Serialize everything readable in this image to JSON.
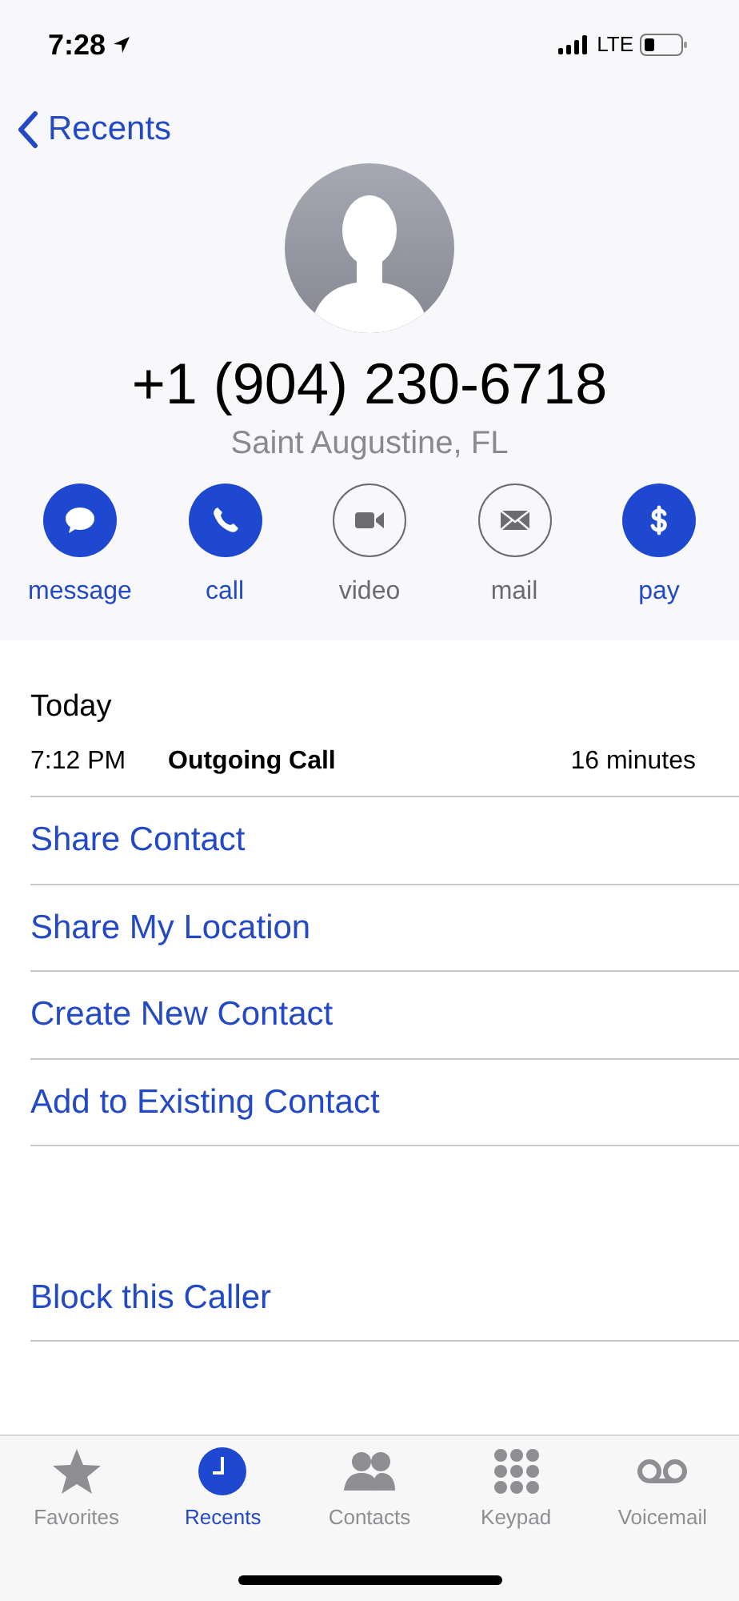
{
  "status_bar": {
    "time": "7:28",
    "network": "LTE"
  },
  "nav": {
    "back_label": "Recents"
  },
  "contact": {
    "number": "+1 (904) 230-6718",
    "location": "Saint Augustine, FL"
  },
  "actions": [
    {
      "kind": "message",
      "label": "message",
      "enabled": true
    },
    {
      "kind": "call",
      "label": "call",
      "enabled": true
    },
    {
      "kind": "video",
      "label": "video",
      "enabled": false
    },
    {
      "kind": "mail",
      "label": "mail",
      "enabled": false
    },
    {
      "kind": "pay",
      "label": "pay",
      "enabled": true
    }
  ],
  "history": {
    "heading": "Today",
    "calls": [
      {
        "time": "7:12 PM",
        "type": "Outgoing Call",
        "duration": "16 minutes"
      }
    ]
  },
  "links": [
    "Share Contact",
    "Share My Location",
    "Create New Contact",
    "Add to Existing Contact"
  ],
  "block_link": "Block this Caller",
  "tabs": [
    {
      "kind": "favorites",
      "label": "Favorites",
      "selected": false
    },
    {
      "kind": "recents",
      "label": "Recents",
      "selected": true
    },
    {
      "kind": "contacts",
      "label": "Contacts",
      "selected": false
    },
    {
      "kind": "keypad",
      "label": "Keypad",
      "selected": false
    },
    {
      "kind": "voicemail",
      "label": "Voicemail",
      "selected": false
    }
  ]
}
